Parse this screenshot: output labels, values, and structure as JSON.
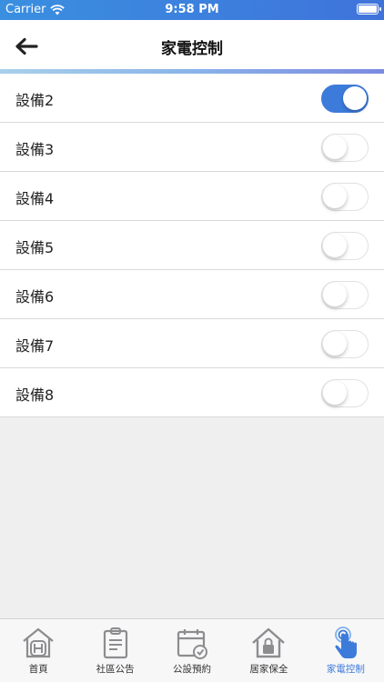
{
  "status_bar": {
    "carrier": "Carrier",
    "time": "9:58 PM"
  },
  "header": {
    "title": "家電控制",
    "back_icon": "arrow-left-icon"
  },
  "devices": [
    {
      "label": "設備2",
      "on": true
    },
    {
      "label": "設備3",
      "on": false
    },
    {
      "label": "設備4",
      "on": false
    },
    {
      "label": "設備5",
      "on": false
    },
    {
      "label": "設備6",
      "on": false
    },
    {
      "label": "設備7",
      "on": false
    },
    {
      "label": "設備8",
      "on": false
    }
  ],
  "tabs": [
    {
      "label": "首頁",
      "icon": "home-icon",
      "active": false
    },
    {
      "label": "社區公告",
      "icon": "clipboard-icon",
      "active": false
    },
    {
      "label": "公設預約",
      "icon": "calendar-icon",
      "active": false
    },
    {
      "label": "居家保全",
      "icon": "house-lock-icon",
      "active": false
    },
    {
      "label": "家電控制",
      "icon": "touch-hand-icon",
      "active": true
    }
  ],
  "colors": {
    "accent": "#3d7bdb",
    "status_bar": "#3a8fe0",
    "background": "#efeff0"
  }
}
